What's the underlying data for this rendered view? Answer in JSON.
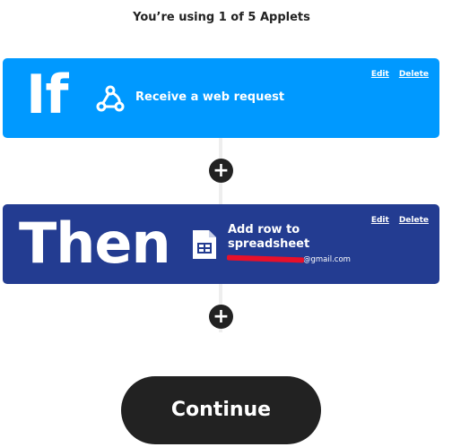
{
  "header": {
    "usage_text": "You’re using 1 of 5 Applets"
  },
  "trigger": {
    "keyword": "If",
    "service_icon": "webhooks-icon",
    "title": "Receive a web request",
    "edit_label": "Edit",
    "delete_label": "Delete",
    "color": "#0099ff"
  },
  "action": {
    "keyword": "Then",
    "service_icon": "spreadsheet-icon",
    "title": "Add row to spreadsheet",
    "account_suffix": "@gmail.com",
    "edit_label": "Edit",
    "delete_label": "Delete",
    "color": "#233c91"
  },
  "add_step_label": "+",
  "continue_label": "Continue"
}
